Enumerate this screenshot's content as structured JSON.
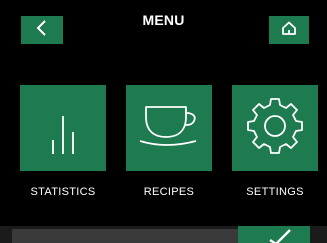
{
  "header": {
    "title": "MENU",
    "back_icon": "chevron-left-icon",
    "home_icon": "home-icon"
  },
  "tiles": [
    {
      "label": "STATISTICS",
      "icon": "bar-chart-icon"
    },
    {
      "label": "RECIPES",
      "icon": "coffee-cup-icon"
    },
    {
      "label": "SETTINGS",
      "icon": "gear-icon"
    }
  ],
  "footer": {
    "confirm_icon": "checkmark-icon"
  },
  "colors": {
    "background": "#000000",
    "accent": "#1e7a4f",
    "text": "#ffffff"
  }
}
